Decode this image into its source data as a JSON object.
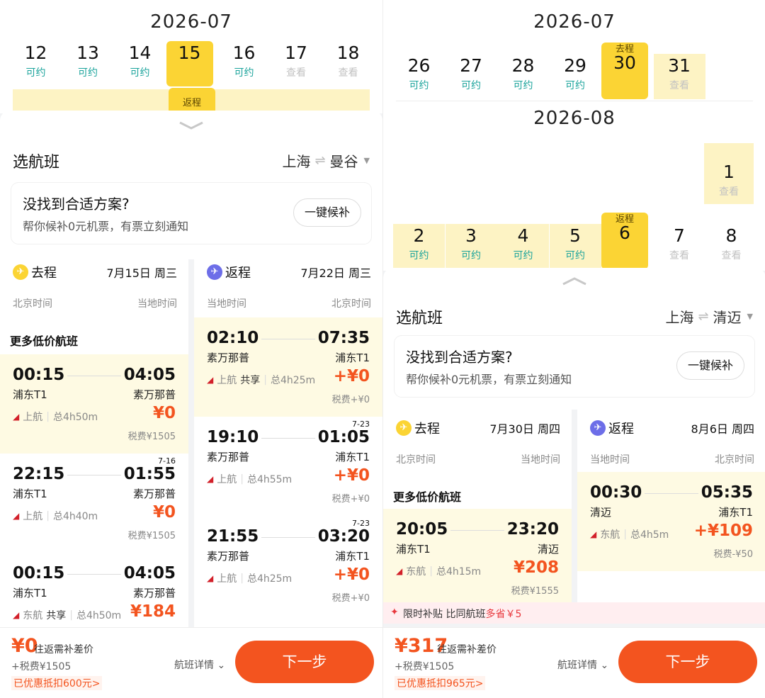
{
  "left": {
    "month": "2026-07",
    "week1": [
      {
        "num": "12",
        "status": "可约",
        "kind": "ok"
      },
      {
        "num": "13",
        "status": "可约",
        "kind": "ok"
      },
      {
        "num": "14",
        "status": "可约",
        "kind": "ok"
      },
      {
        "num": "15",
        "status": "",
        "kind": "sel"
      },
      {
        "num": "16",
        "status": "可约",
        "kind": "ok"
      },
      {
        "num": "17",
        "status": "查看",
        "kind": "view"
      },
      {
        "num": "18",
        "status": "查看",
        "kind": "view"
      }
    ],
    "return_tag": "返程",
    "sheet_title": "选航班",
    "route_from": "上海",
    "route_to": "曼谷",
    "swap": "⇌",
    "tip_title": "没找到合适方案?",
    "tip_sub": "帮你候补0元机票，有票立刻通知",
    "tip_btn": "一键候补",
    "out": {
      "label": "去程",
      "date": "7月15日 周三",
      "tz_l": "北京时间",
      "tz_r": "当地时间",
      "more": "更多低价航班",
      "flights": [
        {
          "dep": "00:15",
          "arr": "04:05",
          "nd": "",
          "from": "浦东T1",
          "to": "素万那普",
          "airline": "上航",
          "share": "",
          "dur": "总4h50m",
          "price": "¥0",
          "tax": "税费¥1505",
          "hl": true
        },
        {
          "dep": "22:15",
          "arr": "01:55",
          "nd": "7-16",
          "from": "浦东T1",
          "to": "素万那普",
          "airline": "上航",
          "share": "",
          "dur": "总4h40m",
          "price": "¥0",
          "tax": "税费¥1505",
          "hl": false
        },
        {
          "dep": "00:15",
          "arr": "04:05",
          "nd": "",
          "from": "浦东T1",
          "to": "素万那普",
          "airline": "东航",
          "share": "共享",
          "dur": "总4h50m",
          "price": "¥184",
          "tax": "",
          "hl": false
        }
      ]
    },
    "ret": {
      "label": "返程",
      "date": "7月22日 周三",
      "tz_l": "当地时间",
      "tz_r": "北京时间",
      "flights": [
        {
          "dep": "02:10",
          "arr": "07:35",
          "nd": "",
          "from": "素万那普",
          "to": "浦东T1",
          "airline": "上航",
          "share": "共享",
          "dur": "总4h25m",
          "price": "+¥0",
          "tax": "税费+¥0",
          "hl": true
        },
        {
          "dep": "19:10",
          "arr": "01:05",
          "nd": "7-23",
          "from": "素万那普",
          "to": "浦东T1",
          "airline": "上航",
          "share": "",
          "dur": "总4h55m",
          "price": "+¥0",
          "tax": "税费+¥0",
          "hl": false
        },
        {
          "dep": "21:55",
          "arr": "03:20",
          "nd": "7-23",
          "from": "素万那普",
          "to": "浦东T1",
          "airline": "上航",
          "share": "",
          "dur": "总4h25m",
          "price": "+¥0",
          "tax": "税费+¥0",
          "hl": false
        }
      ]
    },
    "bottom": {
      "amount": "¥0",
      "note": "往返需补差价",
      "tax": "+税费¥1505",
      "discount": "已优惠抵扣600元>",
      "detail": "航班详情",
      "next": "下一步"
    }
  },
  "right": {
    "month1": "2026-07",
    "week1": [
      {
        "num": "26",
        "status": "可约",
        "kind": "ok",
        "tag": ""
      },
      {
        "num": "27",
        "status": "可约",
        "kind": "ok",
        "tag": ""
      },
      {
        "num": "28",
        "status": "可约",
        "kind": "ok",
        "tag": ""
      },
      {
        "num": "29",
        "status": "可约",
        "kind": "ok",
        "tag": ""
      },
      {
        "num": "30",
        "status": "",
        "kind": "sel",
        "tag": "去程"
      },
      {
        "num": "31",
        "status": "查看",
        "kind": "hlview",
        "tag": ""
      }
    ],
    "month2": "2026-08",
    "aug1": {
      "num": "1",
      "status": "查看"
    },
    "week2": [
      {
        "num": "2",
        "status": "可约",
        "kind": "hlok",
        "tag": ""
      },
      {
        "num": "3",
        "status": "可约",
        "kind": "hlok",
        "tag": ""
      },
      {
        "num": "4",
        "status": "可约",
        "kind": "hlok",
        "tag": ""
      },
      {
        "num": "5",
        "status": "可约",
        "kind": "hlok",
        "tag": ""
      },
      {
        "num": "6",
        "status": "",
        "kind": "sel",
        "tag": "返程"
      },
      {
        "num": "7",
        "status": "查看",
        "kind": "view",
        "tag": ""
      },
      {
        "num": "8",
        "status": "查看",
        "kind": "view",
        "tag": ""
      }
    ],
    "sheet_title": "选航班",
    "route_from": "上海",
    "route_to": "清迈",
    "swap": "⇌",
    "tip_title": "没找到合适方案?",
    "tip_sub": "帮你候补0元机票，有票立刻通知",
    "tip_btn": "一键候补",
    "out": {
      "label": "去程",
      "date": "7月30日 周四",
      "tz_l": "北京时间",
      "tz_r": "当地时间",
      "more": "更多低价航班",
      "flights": [
        {
          "dep": "20:05",
          "arr": "23:20",
          "nd": "",
          "from": "浦东T1",
          "to": "清迈",
          "airline": "东航",
          "share": "",
          "dur": "总4h15m",
          "price": "¥208",
          "tax": "税费¥1555",
          "hl": true
        }
      ]
    },
    "ret": {
      "label": "返程",
      "date": "8月6日 周四",
      "tz_l": "当地时间",
      "tz_r": "北京时间",
      "flights": [
        {
          "dep": "00:30",
          "arr": "05:35",
          "nd": "",
          "from": "清迈",
          "to": "浦东T1",
          "airline": "东航",
          "share": "",
          "dur": "总4h5m",
          "price": "+¥109",
          "tax": "税费-¥50",
          "hl": true
        }
      ]
    },
    "promo": {
      "a": "限时补贴 比同航班",
      "b": "多省￥5"
    },
    "bottom": {
      "amount": "¥317",
      "note": "往返需补差价",
      "tax": "+税费¥1505",
      "discount": "已优惠抵扣965元>",
      "detail": "航班详情",
      "next": "下一步"
    }
  },
  "colors": {
    "accent": "#f3541f",
    "yellow": "#fbd434",
    "highlight": "#fdf3c4",
    "available": "#1aa39b"
  },
  "icons": {
    "chevron": "chevron-up-icon",
    "outbound": "plane-icon",
    "return": "plane-icon",
    "airline": "airline-logo-icon",
    "promo": "flame-icon",
    "caret": "caret-down-icon"
  }
}
